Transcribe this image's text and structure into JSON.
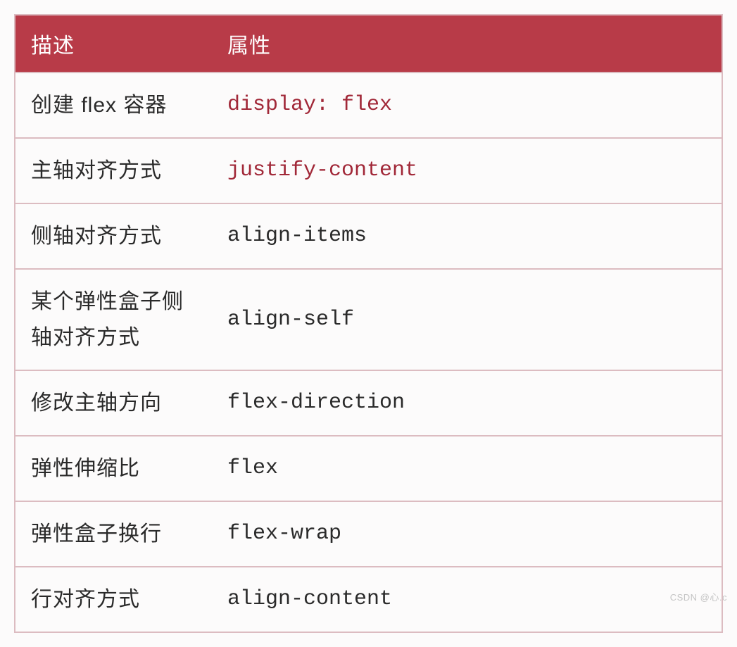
{
  "table": {
    "headers": [
      "描述",
      "属性"
    ],
    "rows": [
      {
        "desc": "创建 flex 容器",
        "prop": "display: flex",
        "highlight": true
      },
      {
        "desc": "主轴对齐方式",
        "prop": "justify-content",
        "highlight": true
      },
      {
        "desc": "侧轴对齐方式",
        "prop": "align-items",
        "highlight": false
      },
      {
        "desc": "某个弹性盒子侧轴对齐方式",
        "prop": "align-self",
        "highlight": false
      },
      {
        "desc": "修改主轴方向",
        "prop": "flex-direction",
        "highlight": false
      },
      {
        "desc": "弹性伸缩比",
        "prop": "flex",
        "highlight": false
      },
      {
        "desc": "弹性盒子换行",
        "prop": "flex-wrap",
        "highlight": false
      },
      {
        "desc": "行对齐方式",
        "prop": "align-content",
        "highlight": false
      }
    ]
  },
  "watermark": "CSDN @心.c"
}
